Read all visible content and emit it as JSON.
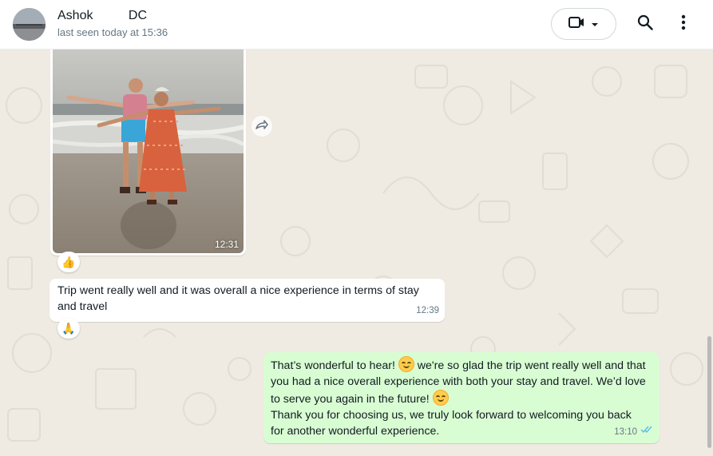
{
  "header": {
    "contact_name": "Ashok          DC",
    "status": "last seen today at 15:36",
    "video_call_icon": "video-camera-icon",
    "dropdown_icon": "caret-down-icon",
    "search_icon": "search-icon",
    "menu_icon": "kebab-menu-icon"
  },
  "messages": [
    {
      "type": "image",
      "direction": "incoming",
      "time": "12:31",
      "reaction": "👍"
    },
    {
      "type": "text",
      "direction": "incoming",
      "lines": [
        "Trip went really well and it was overall a nice experience in terms of stay",
        "and travel"
      ],
      "time": "12:39",
      "reaction": "🙏"
    },
    {
      "type": "text",
      "direction": "outgoing",
      "line1_a": "That’s wonderful to hear! ",
      "line1_b": " we're so glad the trip went really well and that",
      "line2": "you had a nice overall experience with both your stay and travel. We’d love",
      "line3": "to serve you again in the future! ",
      "line4": "Thank you for choosing us, we truly look forward to welcoming you back",
      "line5": "for another wonderful experience.",
      "time": "13:10",
      "status": "read"
    }
  ],
  "colors": {
    "chat_bg": "#efeae2",
    "outgoing_bubble": "#d9fdd3",
    "incoming_bubble": "#ffffff",
    "read_ticks": "#53bdeb"
  }
}
